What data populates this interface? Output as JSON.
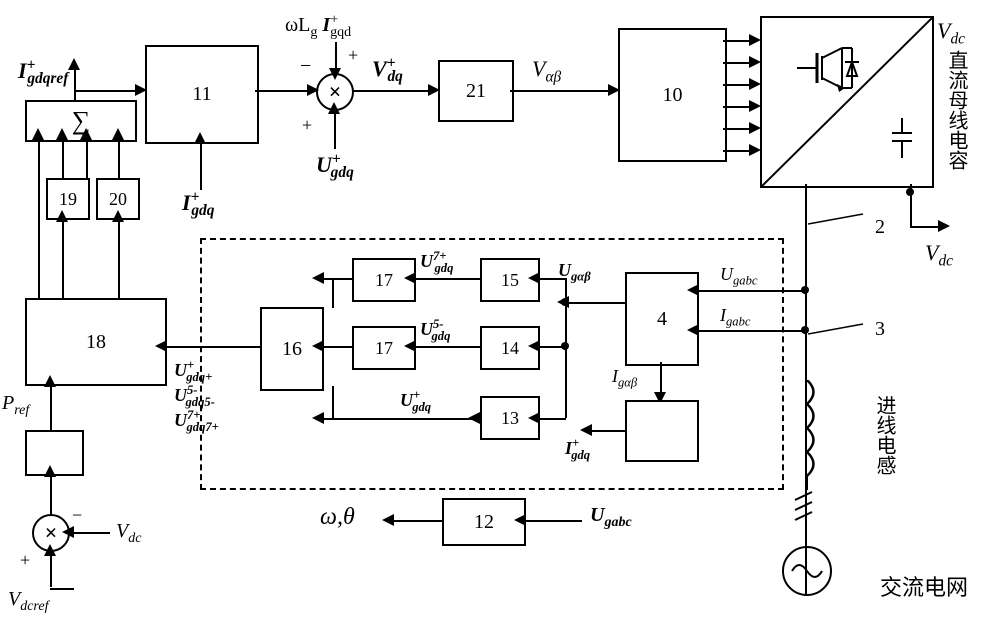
{
  "labels": {
    "igdqref": "I",
    "b11": "11",
    "b21": "21",
    "b10": "10",
    "b19": "19",
    "b20": "20",
    "b18": "18",
    "b17a": "17",
    "b17b": "17",
    "b16": "16",
    "b15": "15",
    "b14": "14",
    "b13": "13",
    "b12": "12",
    "b4": "4",
    "sigma": "∑",
    "sum1_minus": "−",
    "sum1_plus_t": "+",
    "sum1_plus_b": "+",
    "Vdq": "V",
    "Valphabeta": "V",
    "Vdc_top": "V",
    "Vdc_right": "V",
    "wLgIgqd": "ωL",
    "Ugdq": "U",
    "Igdq": "I",
    "Ugabc_in": "U",
    "Igabc_in": "I",
    "Ugalphabeta": "U",
    "Igalphabeta": "I",
    "Igdq_out": "I",
    "Ug7": "U",
    "Ug5": "U",
    "Ugdq_plus": "U",
    "Ugdqplus2": "U",
    "Ugdq5m": "U",
    "Ugdq7p": "U",
    "omega_theta": "ω,θ",
    "Ugabc_pll": "U",
    "Pref": "P",
    "sum2_minus": "−",
    "sum2_plus": "+",
    "Vdc_in": "V",
    "Vdcref": "V",
    "marker2": "2",
    "marker3": "3",
    "dc_bus_cap": "直流母线电容",
    "inline_inductor": "进线电感",
    "ac_grid": "交流电网"
  }
}
